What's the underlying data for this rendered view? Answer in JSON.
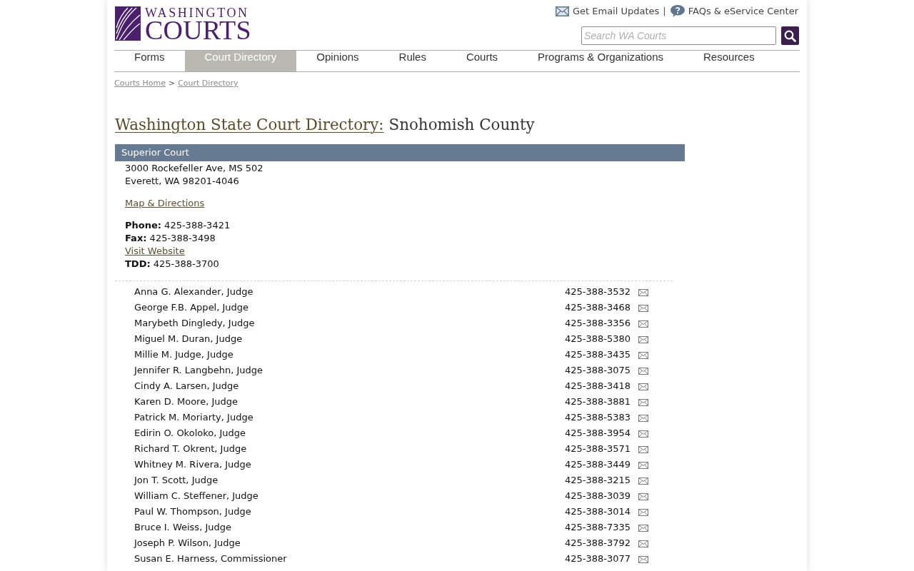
{
  "header": {
    "logo": {
      "line1": "WASHINGTON",
      "line2": "COURTS"
    },
    "top_links": [
      {
        "kind": "email",
        "label": "Get Email Updates"
      },
      {
        "kind": "help",
        "label": "FAQs & eService Center"
      }
    ],
    "separator": "|",
    "search": {
      "placeholder": "Search WA Courts"
    }
  },
  "nav": [
    {
      "label": "Forms",
      "selected": false
    },
    {
      "label": "Court Directory",
      "selected": true
    },
    {
      "label": "Opinions",
      "selected": false
    },
    {
      "label": "Rules",
      "selected": false
    },
    {
      "label": "Courts",
      "selected": false
    },
    {
      "label": "Programs & Organizations",
      "selected": false
    },
    {
      "label": "Resources",
      "selected": false
    }
  ],
  "breadcrumb": {
    "items": [
      "Courts Home",
      "Court Directory"
    ],
    "separator": ">"
  },
  "title": {
    "link": "Washington State Court Directory:",
    "text": "Snohomish County"
  },
  "section": {
    "heading": "Superior Court",
    "address": [
      "3000 Rockefeller Ave, MS 502",
      "Everett, WA 98201-4046"
    ],
    "map_link": "Map & Directions",
    "contacts": [
      {
        "kind": "text",
        "text": "**Phone:** 425-388-3421"
      },
      {
        "kind": "text",
        "text": "**Fax:** 425-388-3498"
      },
      {
        "kind": "link",
        "text": "Visit Website"
      },
      {
        "kind": "text",
        "text": "**TDD:** 425-388-3700"
      }
    ],
    "people": [
      {
        "name": "Anna G. Alexander, Judge",
        "phone": "425-388-3532"
      },
      {
        "name": "George F.B. Appel, Judge",
        "phone": "425-388-3468"
      },
      {
        "name": "Marybeth Dingledy, Judge",
        "phone": "425-388-3356"
      },
      {
        "name": "Miguel M. Duran, Judge",
        "phone": "425-388-5380"
      },
      {
        "name": "Millie M. Judge, Judge",
        "phone": "425-388-3435"
      },
      {
        "name": "Jennifer R. Langbehn, Judge",
        "phone": "425-388-3075"
      },
      {
        "name": "Cindy A. Larsen, Judge",
        "phone": "425-388-3418"
      },
      {
        "name": "Karen D. Moore, Judge",
        "phone": "425-388-3881"
      },
      {
        "name": "Patrick M. Moriarty, Judge",
        "phone": "425-388-5383"
      },
      {
        "name": "Edirin O. Okoloko, Judge",
        "phone": "425-388-3954"
      },
      {
        "name": "Richard T. Okrent, Judge",
        "phone": "425-388-3571"
      },
      {
        "name": "Whitney M. Rivera, Judge",
        "phone": "425-388-3449"
      },
      {
        "name": "Jon T. Scott, Judge",
        "phone": "425-388-3215"
      },
      {
        "name": "William C. Steffener, Judge",
        "phone": "425-388-3039"
      },
      {
        "name": "Paul W. Thompson, Judge",
        "phone": "425-388-3014"
      },
      {
        "name": "Bruce I. Weiss, Judge",
        "phone": "425-388-7335"
      },
      {
        "name": "Joseph P. Wilson, Judge",
        "phone": "425-388-3792"
      },
      {
        "name": "Susan E. Harness, Commissioner",
        "phone": "425-388-3077"
      }
    ]
  }
}
